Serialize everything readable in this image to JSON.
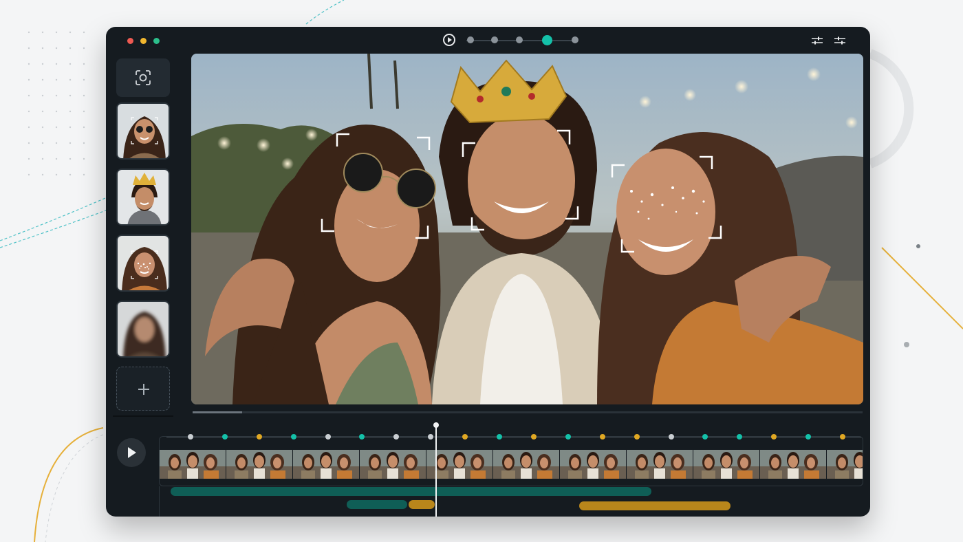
{
  "window": {
    "traffic_lights": [
      "close",
      "minimize",
      "maximize"
    ],
    "colors": {
      "background": "#151b20",
      "accent": "#14c1a9",
      "accent_gold": "#e0a823",
      "accent_teal_dark": "#0f5e56"
    }
  },
  "toolbar": {
    "play_icon": "play-circle-icon",
    "step_count": 5,
    "active_step": 4,
    "right_icons": [
      "sliders-icon",
      "sliders-icon"
    ]
  },
  "sidebar": {
    "detect_icon": "face-scan-icon",
    "faces": [
      {
        "name": "face-sunglasses",
        "effect": "sunglasses"
      },
      {
        "name": "face-crown",
        "effect": "crown"
      },
      {
        "name": "face-glitter",
        "effect": "glitter"
      },
      {
        "name": "face-blurred",
        "effect": "blur"
      }
    ],
    "add_icon": "plus-icon"
  },
  "preview": {
    "description_icons": [
      "sunglasses",
      "crown",
      "glitter"
    ]
  },
  "timeline": {
    "play_icon": "play-icon",
    "keyframe_colors": {
      "grey": "#c9ced2",
      "teal": "#14c1a9",
      "gold": "#e0a823"
    },
    "keyframes": [
      "grey",
      "teal",
      "gold",
      "teal",
      "grey",
      "teal",
      "grey",
      "grey",
      "gold",
      "teal",
      "gold",
      "teal",
      "gold",
      "gold",
      "grey",
      "teal",
      "teal",
      "gold",
      "teal",
      "gold"
    ],
    "frame_count": 11,
    "playhead_position": 0.4
  }
}
